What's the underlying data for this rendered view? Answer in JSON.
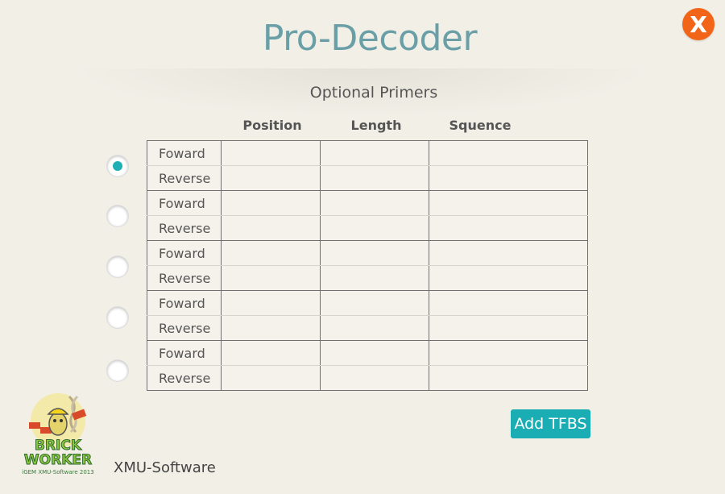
{
  "app": {
    "title": "Pro-Decoder",
    "close_label": "X"
  },
  "section": {
    "title": "Optional Primers"
  },
  "table": {
    "columns": [
      "Position",
      "Length",
      "Squence"
    ],
    "groups": [
      {
        "forward_label": "Foward",
        "reverse_label": "Reverse",
        "selected": true
      },
      {
        "forward_label": "Foward",
        "reverse_label": "Reverse",
        "selected": false
      },
      {
        "forward_label": "Foward",
        "reverse_label": "Reverse",
        "selected": false
      },
      {
        "forward_label": "Foward",
        "reverse_label": "Reverse",
        "selected": false
      },
      {
        "forward_label": "Foward",
        "reverse_label": "Reverse",
        "selected": false
      }
    ]
  },
  "actions": {
    "add_tfbs_label": "Add TFBS"
  },
  "footer": {
    "logo_line1": "BRICK",
    "logo_line2": "WORKER",
    "logo_caption": "iGEM XMU-Software 2013",
    "company": "XMU-Software"
  },
  "colors": {
    "accent": "#1aadb4",
    "close": "#f26418",
    "title": "#6a9fa8",
    "background": "#f1efe6"
  }
}
